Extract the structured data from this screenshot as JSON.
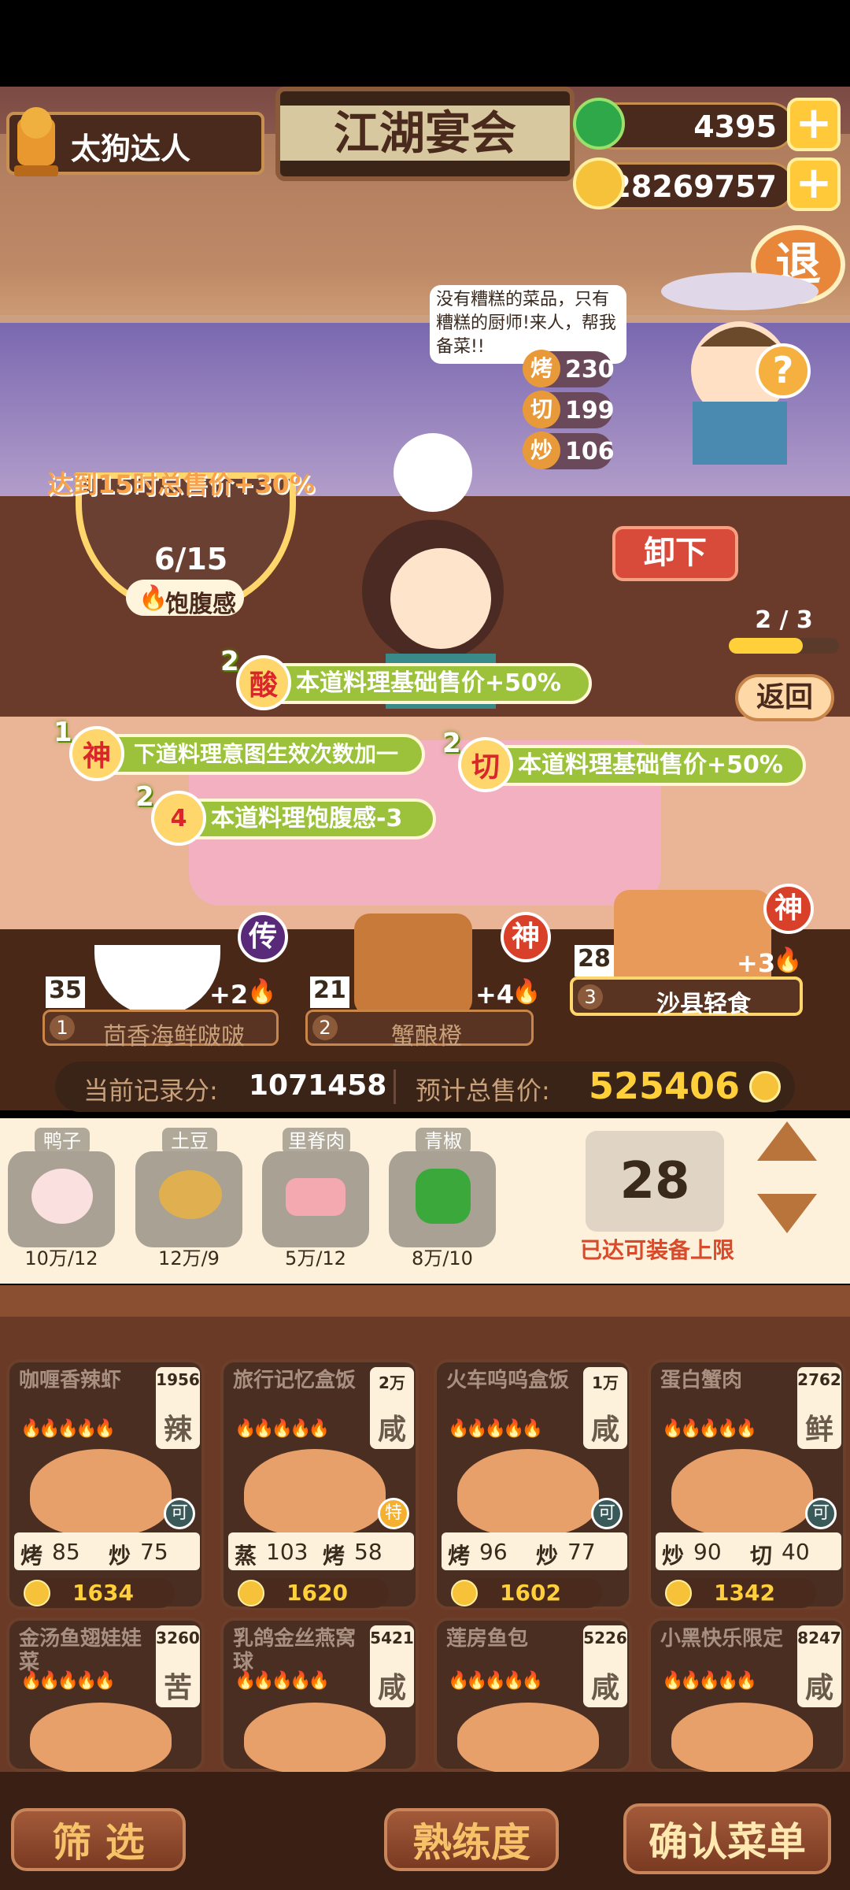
{
  "header": {
    "player_name": "太狗达人",
    "title_sign": "江湖宴会",
    "jade_count": "4395",
    "coin_count": "28269757",
    "exit_label": "退"
  },
  "npc": {
    "speech": "没有糟糕的菜品，只有糟糕的厨师!来人，帮我备菜!!",
    "stats": [
      {
        "icon": "烤",
        "value": "230"
      },
      {
        "icon": "切",
        "value": "199"
      },
      {
        "icon": "炒",
        "value": "106"
      }
    ],
    "unload_label": "卸下",
    "help_label": "?"
  },
  "satiety": {
    "bonus_text": "达到15时总售价+30%",
    "progress": "6/15",
    "current": 6,
    "max": 15,
    "label": "饱腹感"
  },
  "chef_progress": {
    "text": "2 / 3",
    "fraction": 0.67
  },
  "back_label": "返回",
  "buffs": [
    {
      "num": "2",
      "icon": "酸",
      "text": "本道料理基础售价+50%"
    },
    {
      "num": "1",
      "icon": "神",
      "text": "下道料理意图生效次数加一"
    },
    {
      "num": "2",
      "icon": "切",
      "text": "本道料理基础售价+50%"
    },
    {
      "num": "2",
      "icon": "4",
      "text": "本道料理饱腹感-3"
    }
  ],
  "plates": [
    {
      "count": "35",
      "grade": "传",
      "bonus": "+2",
      "index": "1",
      "name": "茴香海鲜啵啵"
    },
    {
      "count": "21",
      "grade": "神",
      "bonus": "+4",
      "index": "2",
      "name": "蟹酿橙"
    },
    {
      "count": "28",
      "grade": "神",
      "bonus": "+3",
      "index": "3",
      "name": "沙县轻食"
    }
  ],
  "score": {
    "record_label": "当前记录分:",
    "record_value": "1071458",
    "total_label": "预计总售价:",
    "total_value": "525406"
  },
  "ingredients": [
    {
      "name": "鸭子",
      "amount": "10万/12"
    },
    {
      "name": "土豆",
      "amount": "12万/9"
    },
    {
      "name": "里脊肉",
      "amount": "5万/12"
    },
    {
      "name": "青椒",
      "amount": "8万/10"
    }
  ],
  "equip": {
    "value": "28",
    "limit_text": "已达可装备上限"
  },
  "dishes": [
    {
      "name": "咖喱香辣虾",
      "count": "1956",
      "taste": "辣",
      "skill1": "烤",
      "v1": "85",
      "skill2": "炒",
      "v2": "75",
      "price": "1634",
      "badge": "可"
    },
    {
      "name": "旅行记忆盒饭",
      "count": "2万",
      "taste": "咸",
      "skill1": "蒸",
      "v1": "103",
      "skill2": "烤",
      "v2": "58",
      "price": "1620",
      "badge": "特"
    },
    {
      "name": "火车呜呜盒饭",
      "count": "1万",
      "taste": "咸",
      "skill1": "烤",
      "v1": "96",
      "skill2": "炒",
      "v2": "77",
      "price": "1602",
      "badge": "可"
    },
    {
      "name": "蛋白蟹肉",
      "count": "2762",
      "taste": "鲜",
      "skill1": "炒",
      "v1": "90",
      "skill2": "切",
      "v2": "40",
      "price": "1342",
      "badge": "可"
    },
    {
      "name": "金汤鱼翅娃娃菜",
      "count": "3260",
      "taste": "苦"
    },
    {
      "name": "乳鸽金丝燕窝球",
      "count": "5421",
      "taste": "咸"
    },
    {
      "name": "莲房鱼包",
      "count": "5226",
      "taste": "咸"
    },
    {
      "name": "小黑快乐限定",
      "count": "8247",
      "taste": "咸"
    }
  ],
  "bottom": {
    "filter": "筛 选",
    "proficiency": "熟练度",
    "confirm": "确认菜单"
  },
  "colors": {
    "accent_gold": "#f7c948",
    "green_tag": "#9bc23a",
    "price_red": "#d8262a"
  }
}
